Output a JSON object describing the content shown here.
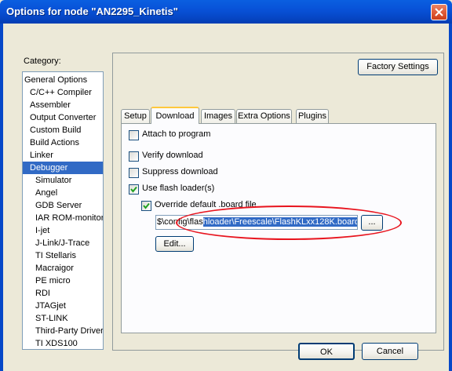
{
  "window": {
    "title": "Options for node \"AN2295_Kinetis\""
  },
  "category": {
    "label": "Category:",
    "items": [
      {
        "label": "General Options",
        "indent": 0,
        "selected": false
      },
      {
        "label": "C/C++ Compiler",
        "indent": 1,
        "selected": false
      },
      {
        "label": "Assembler",
        "indent": 1,
        "selected": false
      },
      {
        "label": "Output Converter",
        "indent": 1,
        "selected": false
      },
      {
        "label": "Custom Build",
        "indent": 1,
        "selected": false
      },
      {
        "label": "Build Actions",
        "indent": 1,
        "selected": false
      },
      {
        "label": "Linker",
        "indent": 1,
        "selected": false
      },
      {
        "label": "Debugger",
        "indent": 1,
        "selected": true
      },
      {
        "label": "Simulator",
        "indent": 2,
        "selected": false
      },
      {
        "label": "Angel",
        "indent": 2,
        "selected": false
      },
      {
        "label": "GDB Server",
        "indent": 2,
        "selected": false
      },
      {
        "label": "IAR ROM-monitor",
        "indent": 2,
        "selected": false
      },
      {
        "label": "I-jet",
        "indent": 2,
        "selected": false
      },
      {
        "label": "J-Link/J-Trace",
        "indent": 2,
        "selected": false
      },
      {
        "label": "TI Stellaris",
        "indent": 2,
        "selected": false
      },
      {
        "label": "Macraigor",
        "indent": 2,
        "selected": false
      },
      {
        "label": "PE micro",
        "indent": 2,
        "selected": false
      },
      {
        "label": "RDI",
        "indent": 2,
        "selected": false
      },
      {
        "label": "JTAGjet",
        "indent": 2,
        "selected": false
      },
      {
        "label": "ST-LINK",
        "indent": 2,
        "selected": false
      },
      {
        "label": "Third-Party Driver",
        "indent": 2,
        "selected": false
      },
      {
        "label": "TI XDS100",
        "indent": 2,
        "selected": false
      }
    ]
  },
  "factory_settings_label": "Factory Settings",
  "tabs": [
    {
      "label": "Setup",
      "active": false
    },
    {
      "label": "Download",
      "active": true
    },
    {
      "label": "Images",
      "active": false
    },
    {
      "label": "Extra Options",
      "active": false
    },
    {
      "label": "Plugins",
      "active": false
    }
  ],
  "download": {
    "attach_to_program": {
      "label": "Attach to program",
      "checked": false
    },
    "verify_download": {
      "label": "Verify download",
      "checked": false
    },
    "suppress_download": {
      "label": "Suppress download",
      "checked": false
    },
    "use_flash_loader": {
      "label": "Use flash loader(s)",
      "checked": true
    },
    "override_board_file": {
      "label": "Override default .board file",
      "checked": true
    },
    "board_path_plain": "$\\config\\flas",
    "board_path_selected": "hloader\\Freescale\\FlashKLxx128K.board",
    "browse_label": "...",
    "edit_label": "Edit..."
  },
  "footer": {
    "ok_label": "OK",
    "cancel_label": "Cancel"
  },
  "colors": {
    "title_blue": "#0648c8",
    "selection_blue": "#316ac5",
    "annotation_red": "#e8141e",
    "tab_highlight": "#ffc83c"
  }
}
